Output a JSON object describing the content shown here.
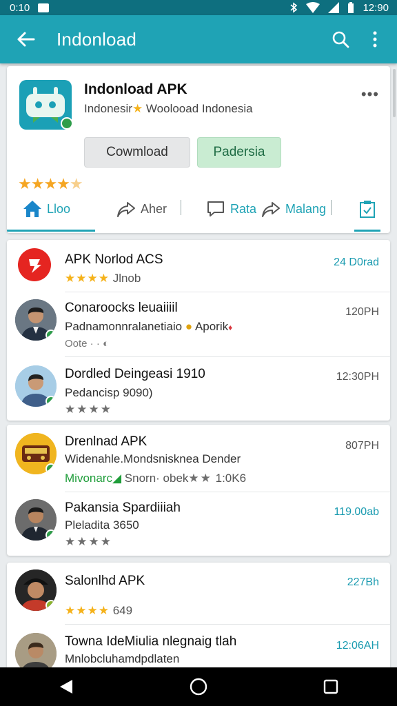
{
  "status_bar": {
    "time_left": "0:10",
    "time_right": "12:90"
  },
  "app_bar": {
    "title": "Indonload"
  },
  "app_card": {
    "name": "Indonload APK",
    "subtitle_left": "Indonesir",
    "subtitle_right": "Woolooad Indonesia",
    "button_download": "Cowmload",
    "button_green": "Padersia",
    "rating_stars": "★★★★",
    "rating_partial": "★",
    "tabs": [
      {
        "label": "Lloo"
      },
      {
        "label": "Aher"
      },
      {
        "label": "Rata"
      },
      {
        "label": "Malang"
      }
    ]
  },
  "list": [
    {
      "title": "APK Norlod ACS",
      "meta_stars": "★★★★",
      "meta_text": "Jlnob",
      "time": "24 D0rad",
      "time_teal": true
    },
    {
      "title": "Conaroocks leuaiiiil",
      "sub": "Padnamonnralanetiaio",
      "sub_extra": "Aporik",
      "meta_text": "Oote · ·",
      "time": "120PH",
      "time_teal": false
    },
    {
      "title": "Dordled Deingeasi 1910",
      "sub": "Pedancisp 9090)",
      "meta_stars_gray": "★★★★",
      "time": "12:30PH",
      "time_teal": false
    },
    {
      "title": "Drenlnad APK",
      "sub": "Widenahle.Mondsnisknea Dender",
      "meta_green": "Mivonarc",
      "meta_text": "Snorn· obek",
      "meta_stars_gray": "★★",
      "meta_count": "1:0K6",
      "time": "807PH",
      "time_teal": false
    },
    {
      "title": "Pakansia Spardiiiah",
      "sub": "Pleladita 3650",
      "meta_stars_gray": "★★★★",
      "time": "119.00ab",
      "time_teal": true
    },
    {
      "title": "Salonlhd APK",
      "meta_stars": "★★★★",
      "meta_text": "649",
      "time": "227Bh",
      "time_teal": true
    },
    {
      "title": "Towna IdeMiulia nlegnaig tlah",
      "sub": "Mnlobcluhamdpdlaten",
      "time": "12:06AH",
      "time_teal": true
    }
  ],
  "colors": {
    "primary": "#1fa3b5",
    "status_bar": "#0e6f7f",
    "star": "#f5b21b",
    "verified": "#2e9d4a"
  },
  "icons": [
    "back-arrow-icon",
    "search-icon",
    "more-vert-icon",
    "home-icon",
    "share-icon",
    "chat-icon",
    "forward-icon",
    "clipboard-icon",
    "nav-back-icon",
    "nav-home-icon",
    "nav-recents-icon"
  ]
}
